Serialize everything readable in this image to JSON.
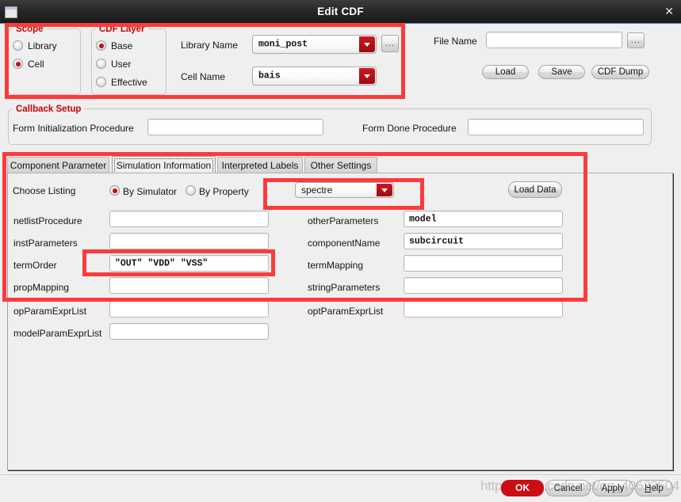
{
  "window": {
    "title": "Edit CDF",
    "close_glyph": "✕"
  },
  "scope": {
    "legend": "Scope",
    "options": [
      {
        "label": "Library",
        "selected": false
      },
      {
        "label": "Cell",
        "selected": true
      }
    ]
  },
  "cdf_layer": {
    "legend": "CDF Layer",
    "options": [
      {
        "label": "Base",
        "selected": true
      },
      {
        "label": "User",
        "selected": false
      },
      {
        "label": "Effective",
        "selected": false
      }
    ]
  },
  "names": {
    "library_label": "Library Name",
    "library_value": "moni_post",
    "cell_label": "Cell Name",
    "cell_value": "bais",
    "browse_label": "..."
  },
  "file": {
    "label": "File Name",
    "value": "",
    "browse_label": "...",
    "buttons": [
      {
        "label": "Load"
      },
      {
        "label": "Save"
      },
      {
        "label": "CDF Dump"
      }
    ]
  },
  "callback": {
    "legend": "Callback Setup",
    "init_label": "Form Initialization Procedure",
    "init_value": "",
    "done_label": "Form Done Procedure",
    "done_value": ""
  },
  "tabs": [
    {
      "label": "Component Parameter",
      "active": false
    },
    {
      "label": "Simulation Information",
      "active": true
    },
    {
      "label": "Interpreted Labels",
      "active": false
    },
    {
      "label": "Other Settings",
      "active": false
    }
  ],
  "listing": {
    "label": "Choose Listing",
    "options": [
      {
        "label": "By Simulator",
        "selected": true
      },
      {
        "label": "By Property",
        "selected": false
      }
    ],
    "simulator_value": "spectre",
    "load_data_label": "Load Data"
  },
  "params_left": [
    {
      "label": "netlistProcedure",
      "value": ""
    },
    {
      "label": "instParameters",
      "value": ""
    },
    {
      "label": "termOrder",
      "value": "\"OUT\"  \"VDD\"  \"VSS\""
    },
    {
      "label": "propMapping",
      "value": ""
    },
    {
      "label": "opParamExprList",
      "value": ""
    },
    {
      "label": "modelParamExprList",
      "value": ""
    }
  ],
  "params_right": [
    {
      "label": "otherParameters",
      "value": "model"
    },
    {
      "label": "componentName",
      "value": "subcircuit"
    },
    {
      "label": "termMapping",
      "value": ""
    },
    {
      "label": "stringParameters",
      "value": ""
    },
    {
      "label": "optParamExprList",
      "value": ""
    }
  ],
  "footer": {
    "ok_label": "OK",
    "cancel_label": "Cancel",
    "apply_label": "Apply",
    "help_label": "Help",
    "help_prefix": "H",
    "help_rest": "elp",
    "watermark": "https://blog.csdn.net/qq_40623504"
  },
  "colors": {
    "annotation_red": "#fb3b3b",
    "legend_red": "#cc0000",
    "radio_red": "#c40f16",
    "combo_arrow_red": "#b4121a",
    "titlebar_dark": "#242424"
  }
}
